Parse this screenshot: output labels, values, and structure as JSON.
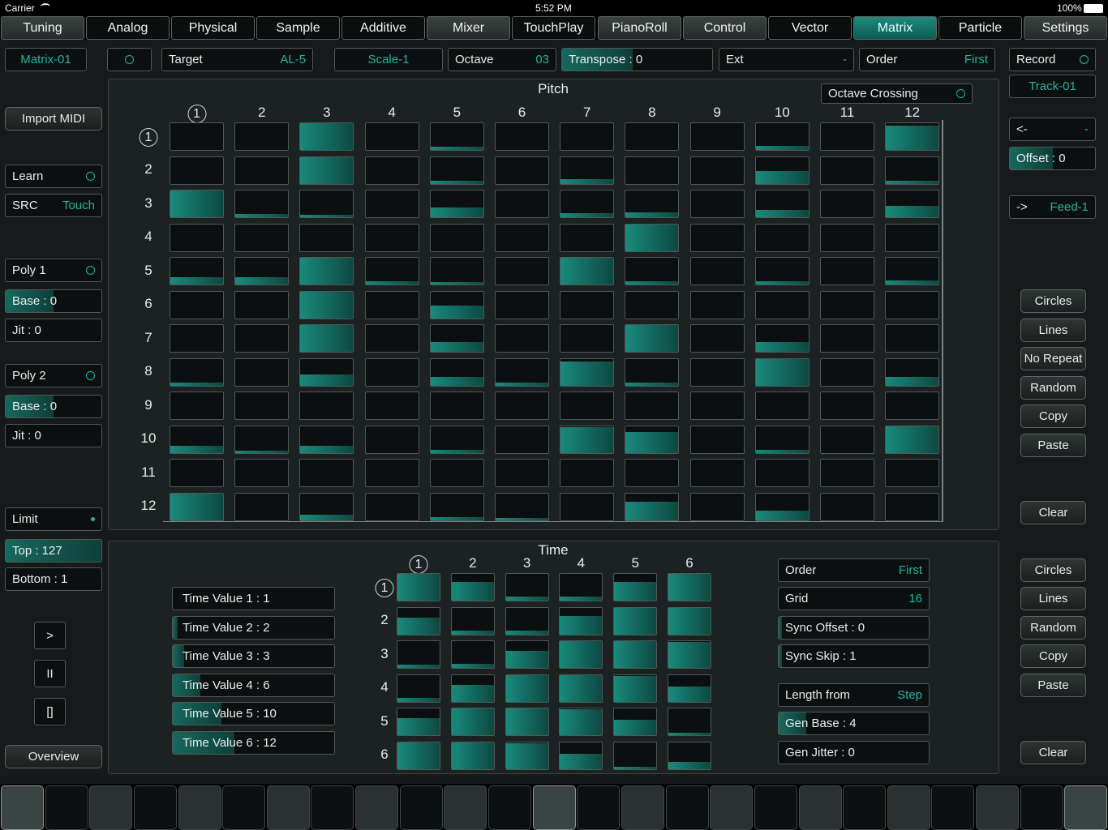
{
  "status": {
    "carrier": "Carrier",
    "time": "5:52 PM",
    "battery": "100%"
  },
  "tabs": [
    {
      "label": "Tuning",
      "style": "gray"
    },
    {
      "label": "Analog",
      "style": ""
    },
    {
      "label": "Physical",
      "style": ""
    },
    {
      "label": "Sample",
      "style": ""
    },
    {
      "label": "Additive",
      "style": ""
    },
    {
      "label": "Mixer",
      "style": "gray"
    },
    {
      "label": "TouchPlay",
      "style": ""
    },
    {
      "label": "PianoRoll",
      "style": "gray"
    },
    {
      "label": "Control",
      "style": "gray"
    },
    {
      "label": "Vector",
      "style": ""
    },
    {
      "label": "Matrix",
      "style": "active"
    },
    {
      "label": "Particle",
      "style": ""
    },
    {
      "label": "Settings",
      "style": "gray"
    }
  ],
  "topbar": {
    "matrix": "Matrix-01",
    "target_label": "Target",
    "target_value": "AL-5",
    "scale": "Scale-1",
    "octave_label": "Octave",
    "octave_value": "03",
    "transpose": "Transpose : 0",
    "ext_label": "Ext",
    "ext_value": "-",
    "order_label": "Order",
    "order_value": "First",
    "record_label": "Record",
    "track": "Track-01"
  },
  "left": {
    "import_midi": "Import MIDI",
    "learn": "Learn",
    "src_label": "SRC",
    "src_value": "Touch",
    "poly1": "Poly 1",
    "base1": "Base : 0",
    "jit1": "Jit : 0",
    "poly2": "Poly 2",
    "base2": "Base : 0",
    "jit2": "Jit : 0",
    "limit": "Limit",
    "top": "Top : 127",
    "bottom": "Bottom : 1",
    "play": ">",
    "pause": "II",
    "stop": "[]",
    "overview": "Overview"
  },
  "right": {
    "back_label": "<-",
    "back_value": "-",
    "offset": "Offset : 0",
    "feed_label": "->",
    "feed_value": "Feed-1",
    "pitch_buttons": [
      "Circles",
      "Lines",
      "No Repeat",
      "Random",
      "Copy",
      "Paste"
    ],
    "pitch_clear": "Clear",
    "time_buttons": [
      "Circles",
      "Lines",
      "Random",
      "Copy",
      "Paste"
    ],
    "time_clear": "Clear"
  },
  "pitch": {
    "title": "Pitch",
    "octave_crossing": "Octave Crossing",
    "cols": [
      "1",
      "2",
      "3",
      "4",
      "5",
      "6",
      "7",
      "8",
      "9",
      "10",
      "11",
      "12"
    ],
    "rows": [
      "1",
      "2",
      "3",
      "4",
      "5",
      "6",
      "7",
      "8",
      "9",
      "10",
      "11",
      "12"
    ],
    "levels": [
      [
        0,
        0,
        1,
        0,
        0.1,
        0,
        0,
        0,
        0,
        0.15,
        0,
        0.85
      ],
      [
        0,
        0,
        1,
        0,
        0.12,
        0,
        0.18,
        0,
        0,
        0.45,
        0,
        0.12
      ],
      [
        1,
        0.12,
        0.05,
        0,
        0.35,
        0,
        0.15,
        0.18,
        0,
        0.25,
        0,
        0.4
      ],
      [
        0,
        0,
        0,
        0,
        0,
        0,
        0,
        1,
        0,
        0,
        0,
        0
      ],
      [
        0.25,
        0.25,
        1,
        0.1,
        0.05,
        0,
        1,
        0.12,
        0,
        0.12,
        0,
        0.15
      ],
      [
        0,
        0,
        1,
        0,
        0.45,
        0,
        0,
        0,
        0,
        0,
        0,
        0
      ],
      [
        0,
        0,
        0.95,
        0,
        0.35,
        0,
        0,
        1,
        0,
        0.35,
        0,
        0
      ],
      [
        0.12,
        0,
        0.4,
        0,
        0.3,
        0.1,
        0.85,
        0.12,
        0,
        1,
        0,
        0.3
      ],
      [
        0,
        0,
        0,
        0,
        0,
        0,
        0,
        0,
        0,
        0,
        0,
        0
      ],
      [
        0.25,
        0.05,
        0.25,
        0,
        0.12,
        0,
        0.9,
        0.75,
        0,
        0.1,
        0,
        1
      ],
      [
        0,
        0,
        0,
        0,
        0,
        0,
        0,
        0,
        0,
        0,
        0,
        0
      ],
      [
        1,
        0,
        0.2,
        0,
        0.1,
        0.05,
        0,
        0.65,
        0,
        0.35,
        0,
        0
      ]
    ]
  },
  "time": {
    "title": "Time",
    "cols": [
      "1",
      "2",
      "3",
      "4",
      "5",
      "6"
    ],
    "rows": [
      "1",
      "2",
      "3",
      "4",
      "5",
      "6"
    ],
    "values": [
      {
        "label": "Time Value 1 : 1",
        "fill": 0.0
      },
      {
        "label": "Time Value 2 : 2",
        "fill": 0.03
      },
      {
        "label": "Time Value 3 : 3",
        "fill": 0.07
      },
      {
        "label": "Time Value 4 : 6",
        "fill": 0.17
      },
      {
        "label": "Time Value 5 : 10",
        "fill": 0.3
      },
      {
        "label": "Time Value 6 : 12",
        "fill": 0.38
      }
    ],
    "levels": [
      [
        1,
        0.65,
        0.15,
        0.15,
        0.65,
        1
      ],
      [
        0.6,
        0.15,
        0.15,
        0.65,
        1,
        1
      ],
      [
        0.1,
        0.15,
        0.6,
        1,
        1,
        0.9
      ],
      [
        0.15,
        0.6,
        1,
        1,
        0.9,
        0.55
      ],
      [
        0.6,
        1,
        1,
        0.9,
        0.55,
        0.05
      ],
      [
        1,
        1,
        0.9,
        0.55,
        0.05,
        0.25
      ]
    ],
    "order_label": "Order",
    "order_value": "First",
    "grid_label": "Grid",
    "grid_value": "16",
    "sync_offset": "Sync Offset : 0",
    "sync_skip": "Sync Skip : 1",
    "length_label": "Length from",
    "length_value": "Step",
    "gen_base": "Gen Base : 4",
    "gen_jitter": "Gen Jitter : 0"
  },
  "keyboard": {
    "count": 25,
    "highlight": [
      0,
      12,
      24
    ]
  }
}
